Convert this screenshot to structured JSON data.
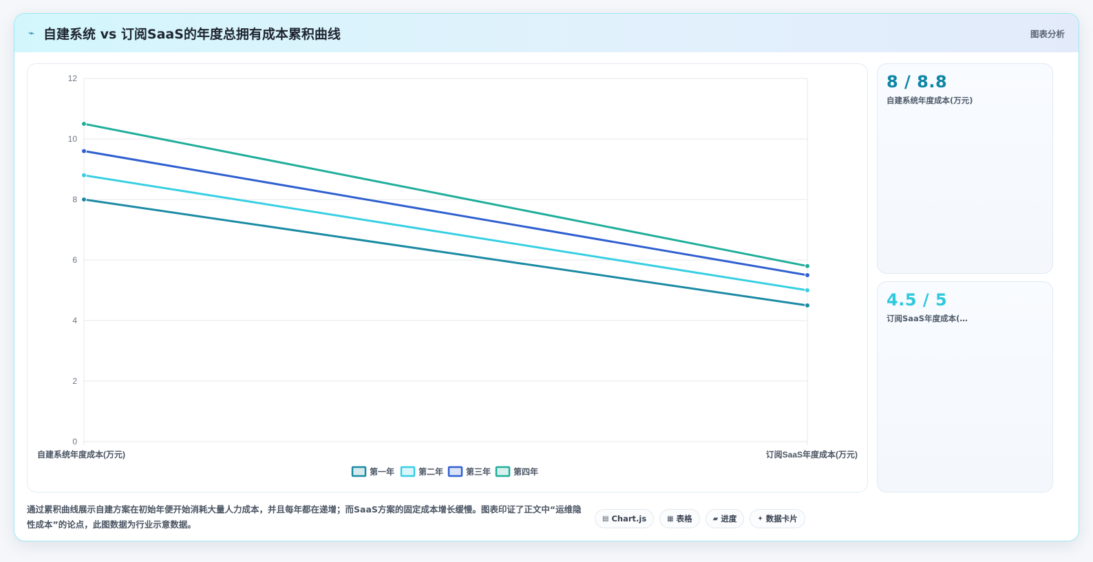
{
  "header": {
    "icon": "lightning-icon",
    "title": "自建系统 vs 订阅SaaS的年度总拥有成本累积曲线",
    "tag": "图表分析"
  },
  "stats": [
    {
      "value": "8 / 8.8",
      "label": "自建系统年度成本(万元)"
    },
    {
      "value": "4.5 / 5",
      "label": "订阅SaaS年度成本(万..."
    }
  ],
  "footer": {
    "description": "通过累积曲线展示自建方案在初始年便开始消耗大量人力成本，并且每年都在递增；而SaaS方案的固定成本增长缓慢。图表印证了正文中“运维隐性成本”的论点，此图数据为行业示意数据。",
    "buttons": [
      {
        "icon": "▤",
        "icon_name": "chart-icon",
        "label": "Chart.js"
      },
      {
        "icon": "▦",
        "icon_name": "table-icon",
        "label": "表格"
      },
      {
        "icon": "▰",
        "icon_name": "progress-icon",
        "label": "进度"
      },
      {
        "icon": "✦",
        "icon_name": "sparkle-icon",
        "label": "数据卡片"
      }
    ]
  },
  "chart_data": {
    "type": "line",
    "categories": [
      "自建系统年度成本(万元)",
      "订阅SaaS年度成本(万元)"
    ],
    "series": [
      {
        "name": "第一年",
        "values": [
          8,
          4.5
        ],
        "color": "#1a8aa3"
      },
      {
        "name": "第二年",
        "values": [
          8.8,
          5
        ],
        "color": "#36cfe2"
      },
      {
        "name": "第三年",
        "values": [
          9.6,
          5.5
        ],
        "color": "#2f5fd0"
      },
      {
        "name": "第四年",
        "values": [
          10.5,
          5.8
        ],
        "color": "#1fae9a"
      }
    ],
    "ylim": [
      0,
      12
    ],
    "yticks": [
      0,
      2,
      4,
      6,
      8,
      10,
      12
    ],
    "grid": true,
    "legend": "bottom"
  }
}
